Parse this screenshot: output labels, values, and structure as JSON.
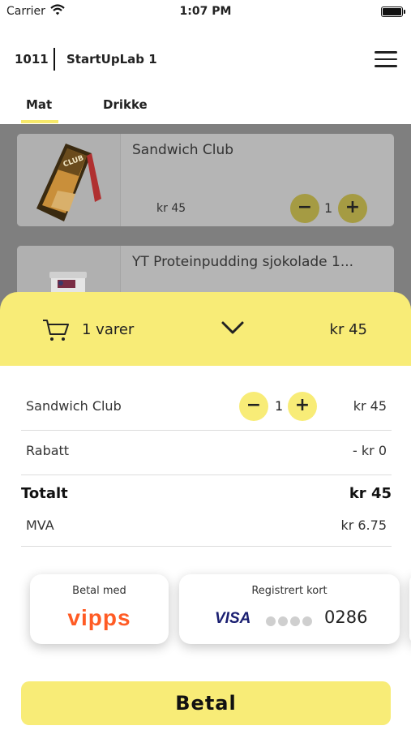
{
  "status_bar": {
    "carrier": "Carrier",
    "time": "1:07 PM"
  },
  "header": {
    "table_number": "1011",
    "venue": "StartUpLab 1"
  },
  "tabs": [
    {
      "label": "Mat",
      "active": true
    },
    {
      "label": "Drikke",
      "active": false
    }
  ],
  "products": [
    {
      "name": "Sandwich Club",
      "price": "kr 45",
      "quantity": "1",
      "icon": "club-sandwich-image"
    },
    {
      "name": "YT Proteinpudding sjokolade 1...",
      "icon": "protein-pudding-image"
    }
  ],
  "cart": {
    "count_label": "1 varer",
    "total": "kr 45",
    "chevron": "chevron-down-icon"
  },
  "order": {
    "item": {
      "name": "Sandwich Club",
      "quantity": "1",
      "price": "kr 45",
      "minus": "−",
      "plus": "+"
    },
    "discount": {
      "label": "Rabatt",
      "value": "- kr 0"
    },
    "total": {
      "label": "Totalt",
      "value": "kr 45"
    },
    "vat": {
      "label": "MVA",
      "value": "kr 6.75"
    }
  },
  "payment": {
    "vipps": {
      "caption": "Betal med",
      "logo": "vipps"
    },
    "card": {
      "caption": "Registrert kort",
      "brand": "VISA",
      "last_digits": "0286"
    }
  },
  "pay_button": "Betal",
  "colors": {
    "accent": "#f8ec77",
    "vipps": "#ff5b24",
    "visa": "#1a1f71"
  }
}
